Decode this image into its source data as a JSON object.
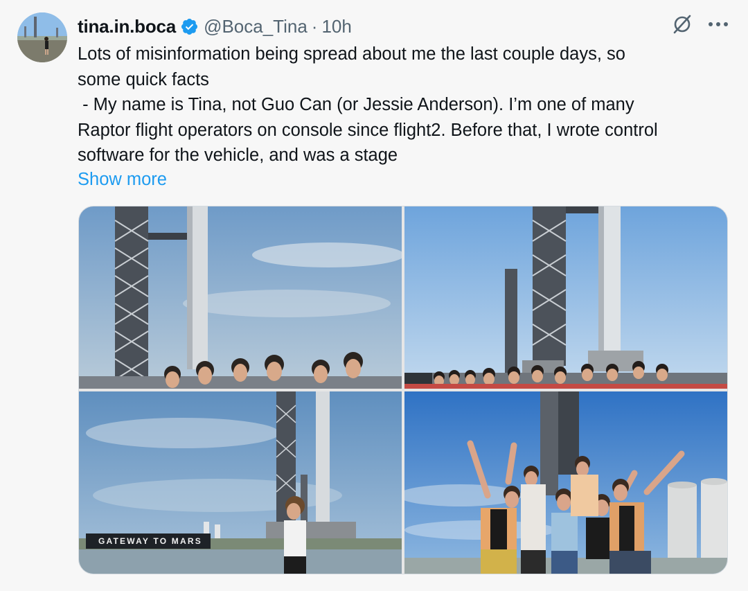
{
  "user": {
    "display_name": "tina.in.boca",
    "handle": "@Boca_Tina",
    "time": "10h",
    "separator": "·"
  },
  "tweet": {
    "text": "Lots of misinformation being spread about me the last couple days, so\nsome quick facts\n - My name is Tina, not Guo Can (or Jessie Anderson). I’m one of many\nRaptor flight operators on console since flight2. Before that, I wrote control\nsoftware for the vehicle, and was a stage",
    "show_more": "Show more"
  },
  "icons": {
    "verified": "verified-badge-icon",
    "grok": "slashed-circle-icon",
    "more": "more-dots-icon"
  },
  "media": {
    "photo3_sign": "GATEWAY TO MARS"
  },
  "colors": {
    "link": "#1d9bf0",
    "verified": "#1d9bf0",
    "muted": "#536471"
  }
}
